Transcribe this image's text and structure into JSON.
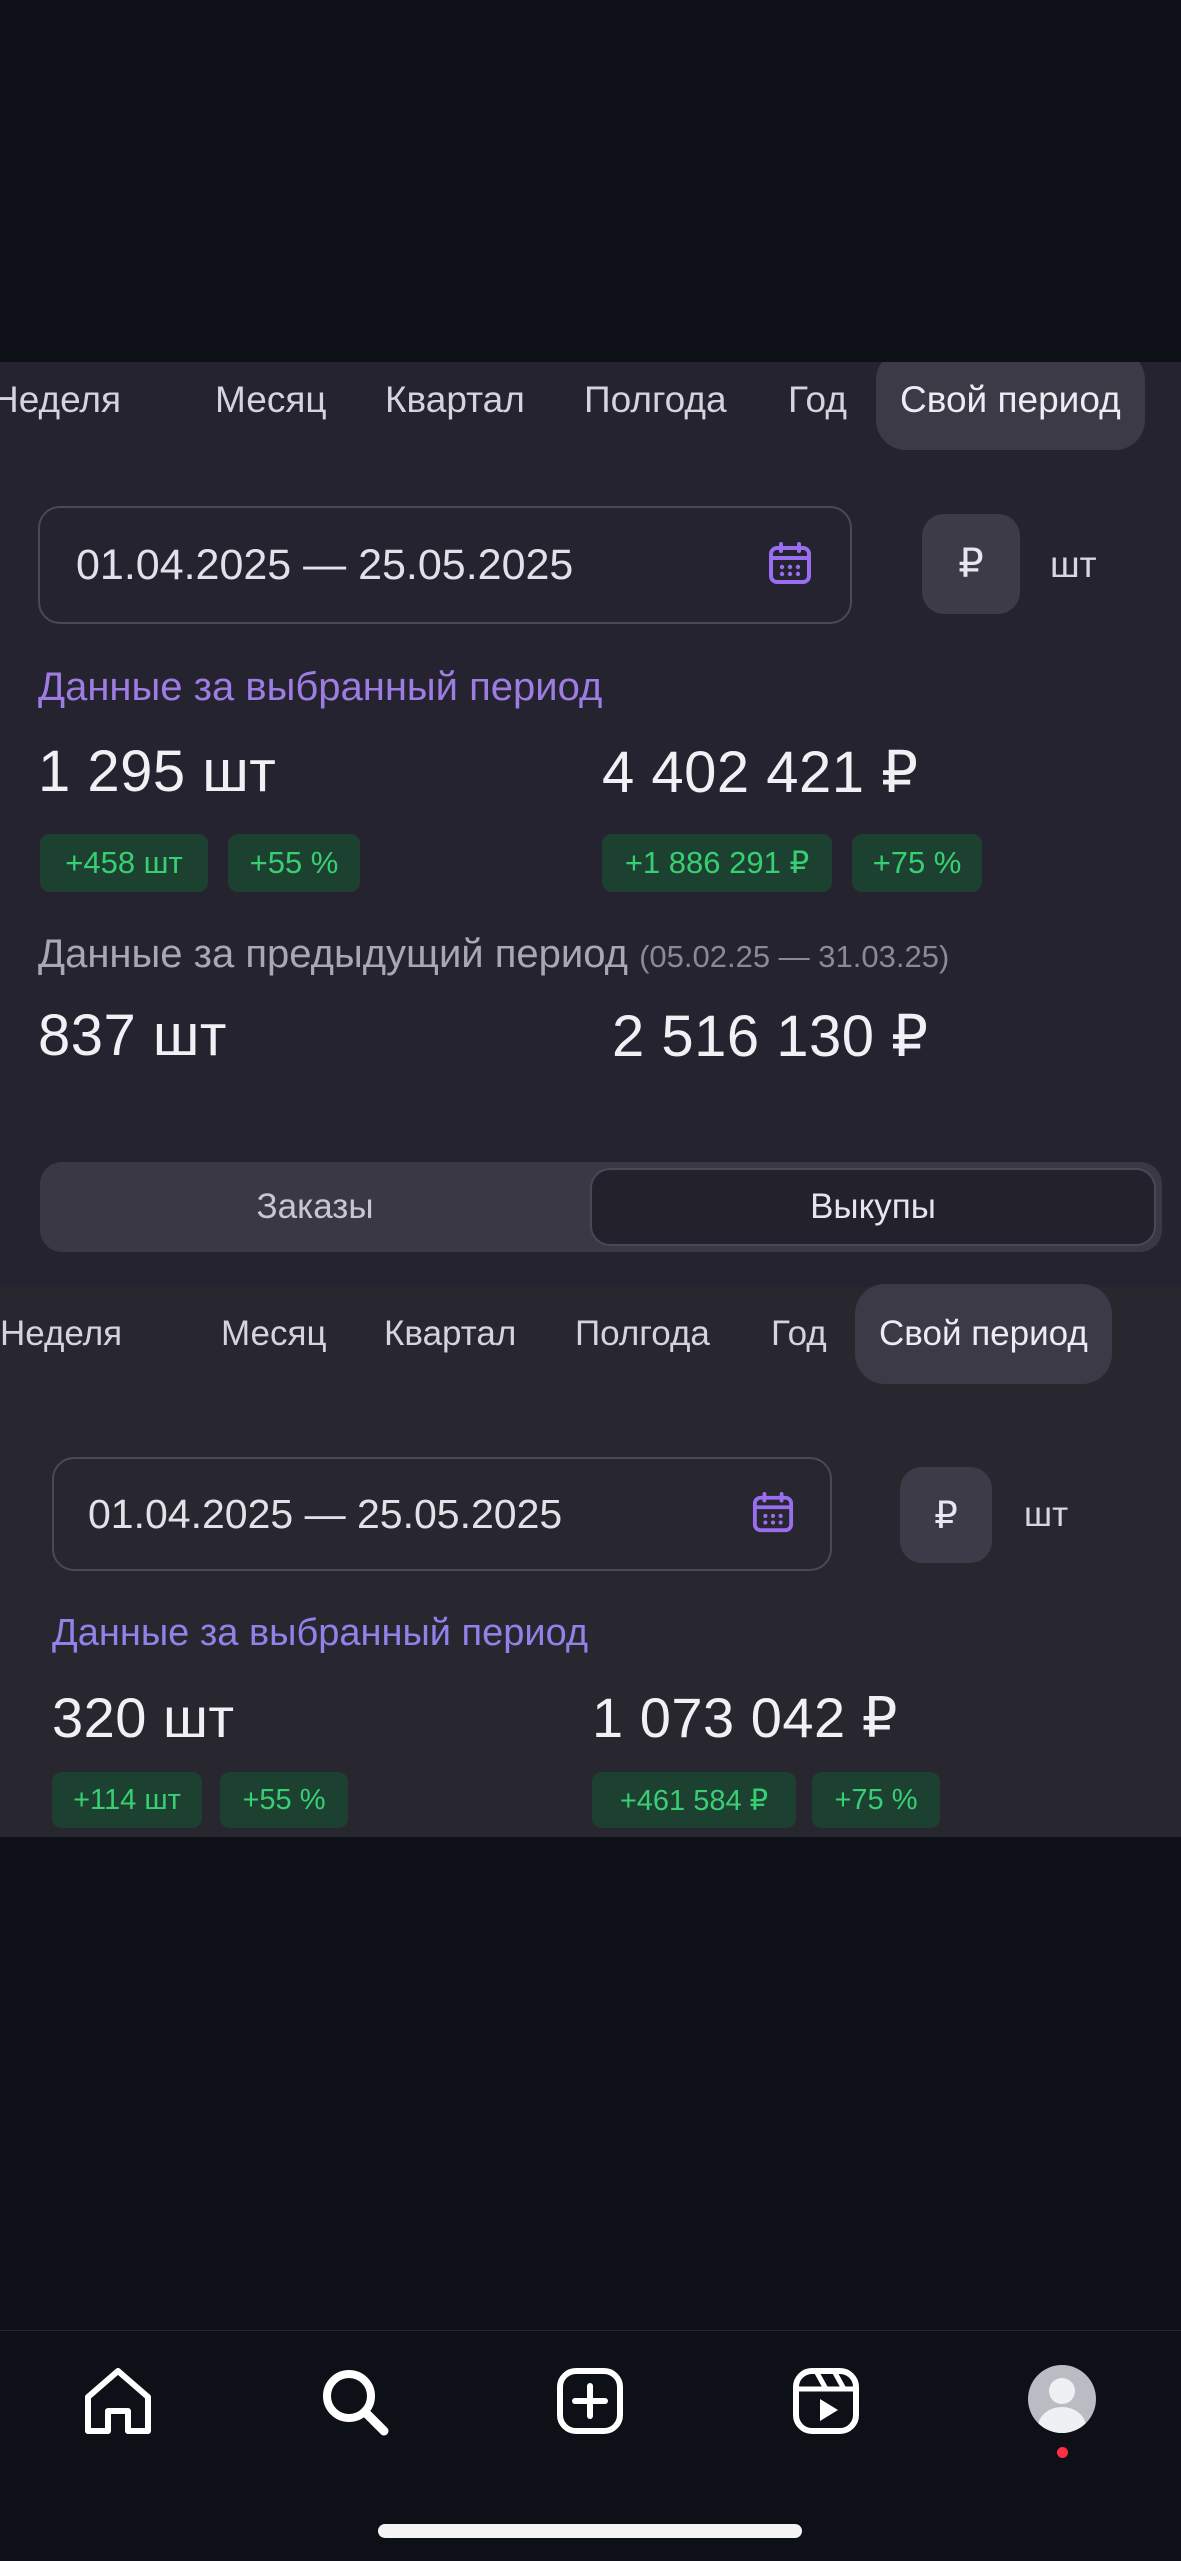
{
  "panel_a": {
    "tabs": [
      "Неделя",
      "Месяц",
      "Квартал",
      "Полгода",
      "Год",
      "Свой период"
    ],
    "active_tab": "Свой период",
    "date_range": "01.04.2025 — 25.05.2025",
    "currency_button": "₽",
    "units_label": "шт",
    "selected_title": "Данные за выбранный период",
    "selected_qty": "1 295 шт",
    "selected_amount": "4 402 421 ₽",
    "qty_delta": "+458 шт",
    "qty_delta_pct": "+55 %",
    "amount_delta": "+1 886 291 ₽",
    "amount_delta_pct": "+75 %",
    "previous_title": "Данные за предыдущий период",
    "previous_range": "(05.02.25 — 31.03.25)",
    "previous_qty": "837 шт",
    "previous_amount": "2 516 130 ₽"
  },
  "segment": {
    "left": "Заказы",
    "right": "Выкупы",
    "active": "Выкупы"
  },
  "panel_b": {
    "tabs": [
      "Неделя",
      "Месяц",
      "Квартал",
      "Полгода",
      "Год",
      "Свой период"
    ],
    "active_tab": "Свой период",
    "date_range": "01.04.2025 — 25.05.2025",
    "currency_button": "₽",
    "units_label": "шт",
    "selected_title": "Данные за выбранный период",
    "selected_qty": "320 шт",
    "selected_amount": "1 073 042 ₽",
    "qty_delta": "+114 шт",
    "qty_delta_pct": "+55 %",
    "amount_delta": "+461 584 ₽",
    "amount_delta_pct": "+75 %"
  },
  "nav": {
    "icons": [
      "home-icon",
      "search-icon",
      "create-post-icon",
      "reels-icon",
      "profile-avatar"
    ]
  },
  "colors": {
    "accent_purple": "#9d7de2",
    "positive_green": "#38cf74",
    "badge_bg": "#1d4130",
    "panel_bg": "#25232f",
    "page_bg": "#0d1016"
  }
}
